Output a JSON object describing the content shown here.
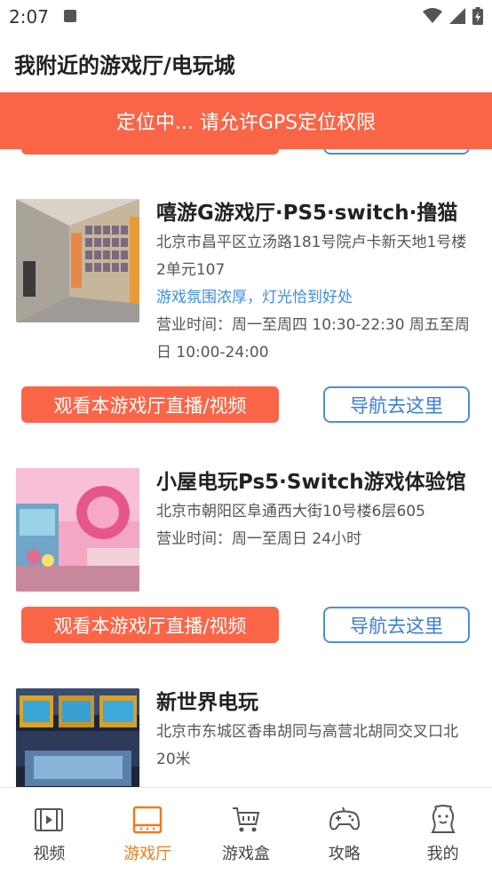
{
  "status_bar": {
    "time": "2:07"
  },
  "header": {
    "title": "我附近的游戏厅/电玩城"
  },
  "gps_banner": {
    "text": "定位中... 请允许GPS定位权限"
  },
  "cards": [
    {
      "name": "嘻游G游戏厅·PS5·switch·撸猫",
      "address": "北京市昌平区立汤路181号院卢卡新天地1号楼2单元107",
      "tag": "游戏氛围浓厚，灯光恰到好处",
      "hours": "营业时间：周一至周四 10:30-22:30 周五至周日 10:00-24:00",
      "live_button": "观看本游戏厅直播/视频",
      "nav_button": "导航去这里"
    },
    {
      "name": "小屋电玩Ps5·Switch游戏体验馆",
      "address": "北京市朝阳区阜通西大街10号楼6层605",
      "hours": "营业时间：周一至周日 24小时",
      "live_button": "观看本游戏厅直播/视频",
      "nav_button": "导航去这里"
    },
    {
      "name": "新世界电玩",
      "address": "北京市东城区香串胡同与高营北胡同交叉口北20米"
    }
  ],
  "tabs": [
    {
      "label": "视频",
      "icon": "film-icon",
      "active": false
    },
    {
      "label": "游戏厅",
      "icon": "arcade-screen-icon",
      "active": true
    },
    {
      "label": "游戏盒",
      "icon": "cart-icon",
      "active": false
    },
    {
      "label": "攻略",
      "icon": "gamepad-icon",
      "active": false
    },
    {
      "label": "我的",
      "icon": "person-face-icon",
      "active": false
    }
  ],
  "colors": {
    "accent": "#fa6548",
    "link": "#3b8de6",
    "nav_border": "#4a90d9",
    "active_tab": "#f07a1c"
  }
}
